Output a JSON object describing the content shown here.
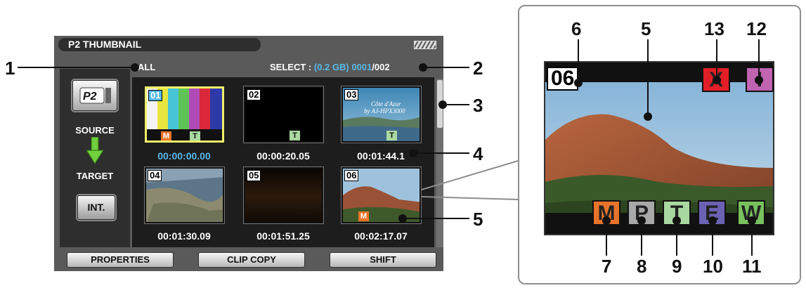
{
  "screen": {
    "title": "P2 THUMBNAIL",
    "filter": "ALL",
    "select_label": "SELECT :",
    "select_size": "(0.2 GB)",
    "select_count": "0001",
    "select_total": "/002"
  },
  "sidebar": {
    "source_label": "SOURCE",
    "target_label": "TARGET",
    "int_label": "INT."
  },
  "clips": [
    {
      "number": "01",
      "timecode": "00:00:00.00",
      "marks": [
        "M",
        "T"
      ]
    },
    {
      "number": "02",
      "timecode": "00:00:20.05",
      "marks": [
        "T"
      ]
    },
    {
      "number": "03",
      "timecode": "00:01:44.1",
      "marks": [
        "T"
      ],
      "overlay_line1": "Côte d'Azur",
      "overlay_line2": "by AJ-HPX3000"
    },
    {
      "number": "04",
      "timecode": "00:01:30.09",
      "marks": []
    },
    {
      "number": "05",
      "timecode": "00:01:51.25",
      "marks": []
    },
    {
      "number": "06",
      "timecode": "00:02:17.07",
      "marks": [
        "M"
      ]
    }
  ],
  "buttons": {
    "properties": "PROPERTIES",
    "clip_copy": "CLIP COPY",
    "shift": "SHIFT"
  },
  "zoom": {
    "clip_number": "06",
    "top_marks": [
      "X",
      "!"
    ],
    "bottom_marks": [
      "M",
      "P",
      "T",
      "E",
      "W"
    ]
  },
  "callouts": [
    "1",
    "2",
    "3",
    "4",
    "5",
    "5",
    "6",
    "5",
    "13",
    "12",
    "7",
    "8",
    "9",
    "10",
    "11"
  ],
  "colors": {
    "highlight": "#57b9e8",
    "selected_border": "#f1f06a",
    "mark_m": "#e8742b",
    "mark_t": "#a9d8a0"
  }
}
